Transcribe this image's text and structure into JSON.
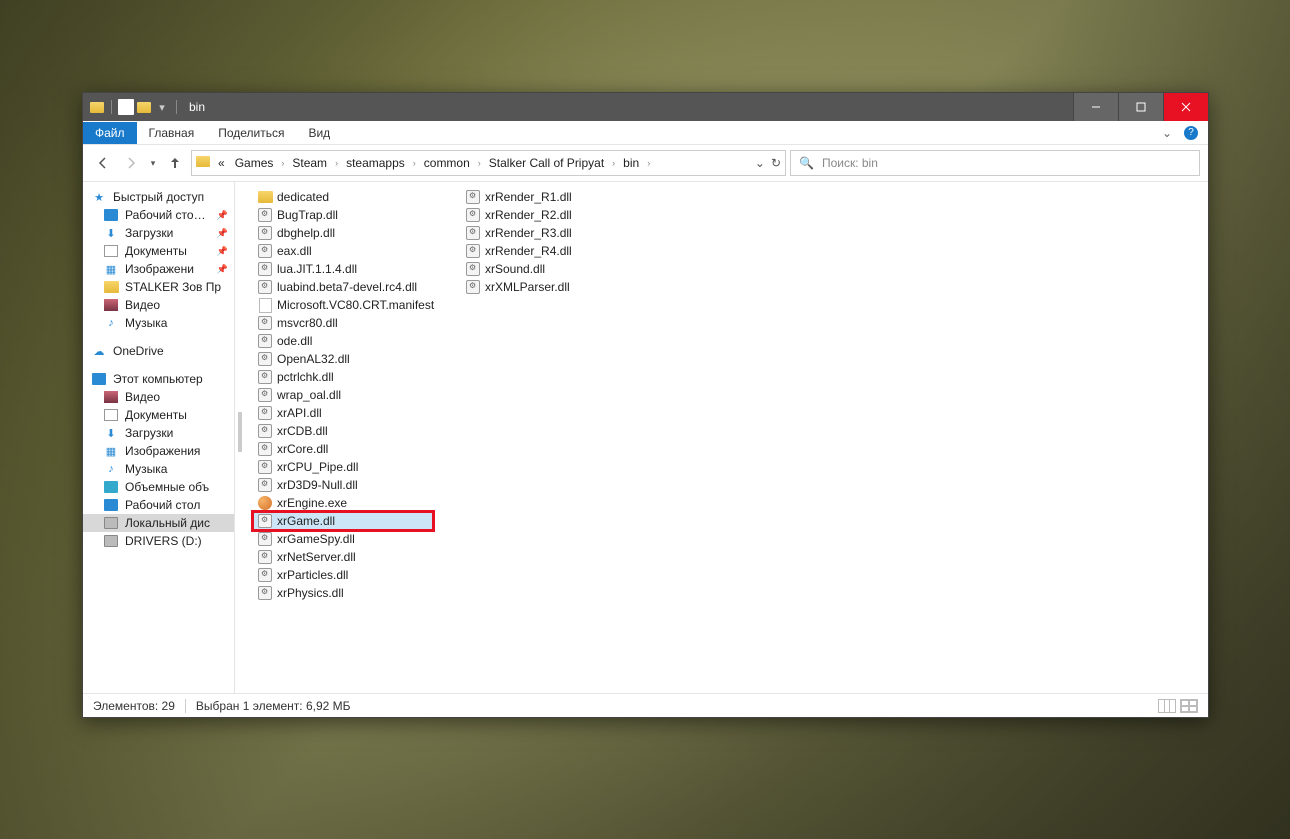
{
  "window": {
    "title": "bin"
  },
  "ribbon": {
    "file": "Файл",
    "home": "Главная",
    "share": "Поделиться",
    "view": "Вид"
  },
  "breadcrumb": {
    "prefix": "«",
    "parts": [
      "Games",
      "Steam",
      "steamapps",
      "common",
      "Stalker Call of Pripyat",
      "bin"
    ]
  },
  "search": {
    "placeholder": "Поиск: bin"
  },
  "nav": {
    "quick": {
      "label": "Быстрый доступ",
      "items": [
        {
          "label": "Рабочий сто…",
          "pinned": true,
          "ico": "ic-desk"
        },
        {
          "label": "Загрузки",
          "pinned": true,
          "ico": "ic-down"
        },
        {
          "label": "Документы",
          "pinned": true,
          "ico": "ic-doc"
        },
        {
          "label": "Изображени",
          "pinned": true,
          "ico": "ic-img"
        },
        {
          "label": "STALKER Зов Пр",
          "pinned": false,
          "ico": "fold"
        },
        {
          "label": "Видео",
          "pinned": false,
          "ico": "ic-vid"
        },
        {
          "label": "Музыка",
          "pinned": false,
          "ico": "ic-mus"
        }
      ]
    },
    "onedrive": {
      "label": "OneDrive"
    },
    "thispc": {
      "label": "Этот компьютер",
      "items": [
        {
          "label": "Видео",
          "ico": "ic-vid"
        },
        {
          "label": "Документы",
          "ico": "ic-doc"
        },
        {
          "label": "Загрузки",
          "ico": "ic-down"
        },
        {
          "label": "Изображения",
          "ico": "ic-img"
        },
        {
          "label": "Музыка",
          "ico": "ic-mus"
        },
        {
          "label": "Объемные объ",
          "ico": "ic-3d"
        },
        {
          "label": "Рабочий стол",
          "ico": "ic-desk"
        },
        {
          "label": "Локальный дис",
          "ico": "ic-drive",
          "selected": true
        },
        {
          "label": "DRIVERS (D:)",
          "ico": "ic-drive"
        }
      ]
    }
  },
  "files": {
    "col1": [
      {
        "name": "dedicated",
        "type": "folder"
      },
      {
        "name": "BugTrap.dll",
        "type": "dll"
      },
      {
        "name": "dbghelp.dll",
        "type": "dll"
      },
      {
        "name": "eax.dll",
        "type": "dll"
      },
      {
        "name": "lua.JIT.1.1.4.dll",
        "type": "dll"
      },
      {
        "name": "luabind.beta7-devel.rc4.dll",
        "type": "dll"
      },
      {
        "name": "Microsoft.VC80.CRT.manifest",
        "type": "txt"
      },
      {
        "name": "msvcr80.dll",
        "type": "dll"
      },
      {
        "name": "ode.dll",
        "type": "dll"
      },
      {
        "name": "OpenAL32.dll",
        "type": "dll"
      },
      {
        "name": "pctrlchk.dll",
        "type": "dll"
      },
      {
        "name": "wrap_oal.dll",
        "type": "dll"
      },
      {
        "name": "xrAPI.dll",
        "type": "dll"
      },
      {
        "name": "xrCDB.dll",
        "type": "dll"
      },
      {
        "name": "xrCore.dll",
        "type": "dll"
      },
      {
        "name": "xrCPU_Pipe.dll",
        "type": "dll"
      },
      {
        "name": "xrD3D9-Null.dll",
        "type": "dll"
      },
      {
        "name": "xrEngine.exe",
        "type": "exe"
      },
      {
        "name": "xrGame.dll",
        "type": "dll",
        "selected": true,
        "highlighted": true
      },
      {
        "name": "xrGameSpy.dll",
        "type": "dll"
      },
      {
        "name": "xrNetServer.dll",
        "type": "dll"
      },
      {
        "name": "xrParticles.dll",
        "type": "dll"
      },
      {
        "name": "xrPhysics.dll",
        "type": "dll"
      }
    ],
    "col2": [
      {
        "name": "xrRender_R1.dll",
        "type": "dll"
      },
      {
        "name": "xrRender_R2.dll",
        "type": "dll"
      },
      {
        "name": "xrRender_R3.dll",
        "type": "dll"
      },
      {
        "name": "xrRender_R4.dll",
        "type": "dll"
      },
      {
        "name": "xrSound.dll",
        "type": "dll"
      },
      {
        "name": "xrXMLParser.dll",
        "type": "dll"
      }
    ]
  },
  "status": {
    "count_label": "Элементов: 29",
    "selection_label": "Выбран 1 элемент: 6,92 МБ"
  }
}
